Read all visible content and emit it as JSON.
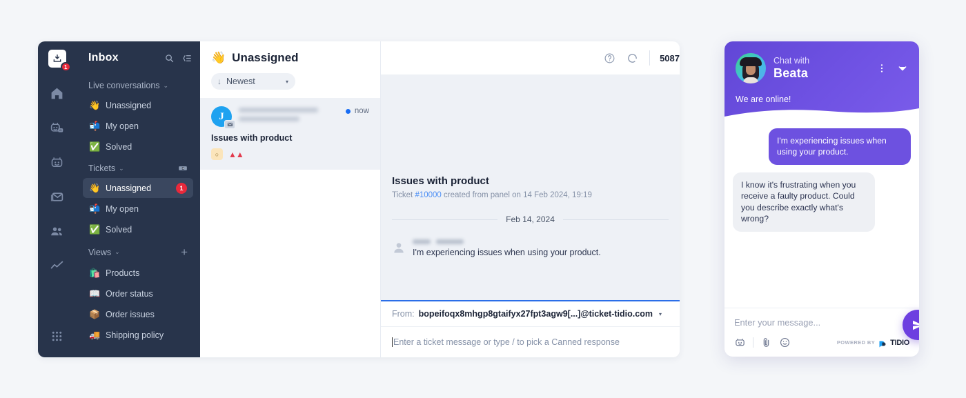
{
  "app": {
    "rail": {
      "logo_badge": "1",
      "icons": [
        {
          "name": "inbox-logo-icon"
        },
        {
          "name": "home-icon"
        },
        {
          "name": "ai-agent-icon"
        },
        {
          "name": "chatbot-icon"
        },
        {
          "name": "email-icon"
        },
        {
          "name": "contacts-icon"
        },
        {
          "name": "analytics-icon"
        },
        {
          "name": "apps-grid-icon"
        }
      ]
    },
    "nav": {
      "title": "Inbox",
      "search_icon": "search-icon",
      "collapse_icon": "collapse-panel-icon",
      "groups": [
        {
          "label": "Live conversations",
          "caret": "⌄",
          "items": [
            {
              "emoji": "👋",
              "label": "Unassigned",
              "count": "",
              "active": false
            },
            {
              "emoji": "📬",
              "label": "My open",
              "count": "",
              "active": false
            },
            {
              "emoji": "✅",
              "label": "Solved",
              "count": "",
              "active": false
            }
          ]
        },
        {
          "label": "Tickets",
          "caret": "⌄",
          "action_icon": "new-ticket-icon",
          "items": [
            {
              "emoji": "👋",
              "label": "Unassigned",
              "count": "1",
              "active": true
            },
            {
              "emoji": "📬",
              "label": "My open",
              "count": "",
              "active": false
            },
            {
              "emoji": "✅",
              "label": "Solved",
              "count": "",
              "active": false
            }
          ]
        },
        {
          "label": "Views",
          "caret": "⌄",
          "action_icon": "add-view-icon",
          "items": [
            {
              "emoji": "🛍️",
              "label": "Products",
              "count": "",
              "active": false
            },
            {
              "emoji": "📖",
              "label": "Order status",
              "count": "",
              "active": false
            },
            {
              "emoji": "📦",
              "label": "Order issues",
              "count": "",
              "active": false
            },
            {
              "emoji": "🚚",
              "label": "Shipping policy",
              "count": "",
              "active": false
            }
          ]
        }
      ]
    },
    "conversation_list": {
      "emoji": "👋",
      "title": "Unassigned",
      "sort": {
        "arrow": "↓",
        "label": "Newest",
        "chevron": "▾"
      },
      "items": [
        {
          "avatar_letter": "J",
          "sender_redacted": true,
          "status_dot": true,
          "time": "now",
          "subject": "Issues with product",
          "tag_badge": "○",
          "priority_icon": "high-priority-icon"
        }
      ]
    },
    "ticket": {
      "help_icon": "help-circle-icon",
      "refresh_icon": "loading-spinner-icon",
      "counter": "5087",
      "subject": "Issues with product",
      "meta_prefix": "Ticket ",
      "meta_id": "#10000",
      "meta_suffix": " created from panel on 14 Feb 2024, 19:19",
      "date_divider": "Feb 14, 2024",
      "message": {
        "author_redacted": true,
        "text": "I'm experiencing issues when using your product."
      },
      "composer": {
        "from_label": "From:",
        "from_value": "bopeifoqx8mhgp8gtaifyx27fpt3agw9[...]@ticket-tidio.com",
        "from_chevron": "▾",
        "placeholder": "Enter a ticket message or type / to pick a Canned response"
      }
    }
  },
  "widget": {
    "header": {
      "chat_with_label": "Chat with",
      "agent_name": "Beata",
      "menu_icon": "kebab-menu-icon",
      "minimize_icon": "chevron-down-icon",
      "status": "We are online!"
    },
    "messages": [
      {
        "from": "visitor",
        "text": "I'm experiencing issues when using your product."
      },
      {
        "from": "agent",
        "text": "I know it's frustrating when you receive a faulty product. Could you describe exactly what's wrong?"
      }
    ],
    "footer": {
      "placeholder": "Enter your message...",
      "bot_icon": "chatbot-icon",
      "attach_icon": "paperclip-icon",
      "emoji_icon": "emoji-smiley-icon",
      "powered_by": "POWERED BY",
      "brand": "TIDIO",
      "send_icon": "send-paper-plane-icon"
    }
  },
  "colors": {
    "sidebar": "#28344b",
    "accent_purple": "#6d51e0",
    "send_purple": "#6d3fe0",
    "badge_red": "#e8293b",
    "link_blue": "#4b8ef5",
    "composer_border": "#2b6ee8",
    "page_bg": "#f4f6f9"
  }
}
